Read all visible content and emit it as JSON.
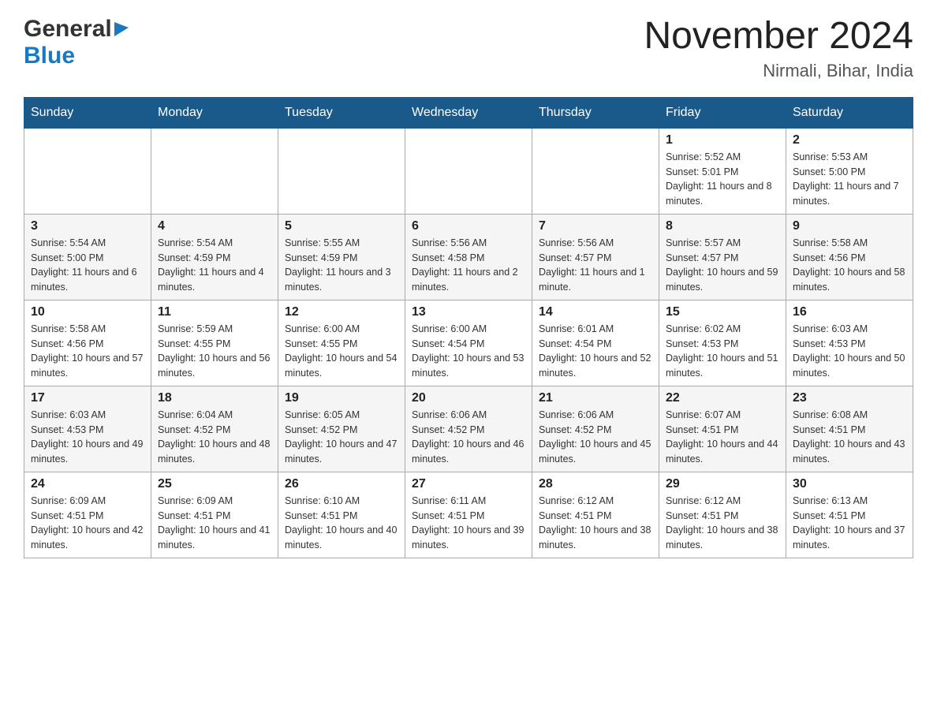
{
  "header": {
    "logo_general": "General",
    "logo_blue": "Blue",
    "month_title": "November 2024",
    "location": "Nirmali, Bihar, India"
  },
  "days_of_week": [
    "Sunday",
    "Monday",
    "Tuesday",
    "Wednesday",
    "Thursday",
    "Friday",
    "Saturday"
  ],
  "weeks": [
    [
      {
        "day": "",
        "info": ""
      },
      {
        "day": "",
        "info": ""
      },
      {
        "day": "",
        "info": ""
      },
      {
        "day": "",
        "info": ""
      },
      {
        "day": "",
        "info": ""
      },
      {
        "day": "1",
        "info": "Sunrise: 5:52 AM\nSunset: 5:01 PM\nDaylight: 11 hours and 8 minutes."
      },
      {
        "day": "2",
        "info": "Sunrise: 5:53 AM\nSunset: 5:00 PM\nDaylight: 11 hours and 7 minutes."
      }
    ],
    [
      {
        "day": "3",
        "info": "Sunrise: 5:54 AM\nSunset: 5:00 PM\nDaylight: 11 hours and 6 minutes."
      },
      {
        "day": "4",
        "info": "Sunrise: 5:54 AM\nSunset: 4:59 PM\nDaylight: 11 hours and 4 minutes."
      },
      {
        "day": "5",
        "info": "Sunrise: 5:55 AM\nSunset: 4:59 PM\nDaylight: 11 hours and 3 minutes."
      },
      {
        "day": "6",
        "info": "Sunrise: 5:56 AM\nSunset: 4:58 PM\nDaylight: 11 hours and 2 minutes."
      },
      {
        "day": "7",
        "info": "Sunrise: 5:56 AM\nSunset: 4:57 PM\nDaylight: 11 hours and 1 minute."
      },
      {
        "day": "8",
        "info": "Sunrise: 5:57 AM\nSunset: 4:57 PM\nDaylight: 10 hours and 59 minutes."
      },
      {
        "day": "9",
        "info": "Sunrise: 5:58 AM\nSunset: 4:56 PM\nDaylight: 10 hours and 58 minutes."
      }
    ],
    [
      {
        "day": "10",
        "info": "Sunrise: 5:58 AM\nSunset: 4:56 PM\nDaylight: 10 hours and 57 minutes."
      },
      {
        "day": "11",
        "info": "Sunrise: 5:59 AM\nSunset: 4:55 PM\nDaylight: 10 hours and 56 minutes."
      },
      {
        "day": "12",
        "info": "Sunrise: 6:00 AM\nSunset: 4:55 PM\nDaylight: 10 hours and 54 minutes."
      },
      {
        "day": "13",
        "info": "Sunrise: 6:00 AM\nSunset: 4:54 PM\nDaylight: 10 hours and 53 minutes."
      },
      {
        "day": "14",
        "info": "Sunrise: 6:01 AM\nSunset: 4:54 PM\nDaylight: 10 hours and 52 minutes."
      },
      {
        "day": "15",
        "info": "Sunrise: 6:02 AM\nSunset: 4:53 PM\nDaylight: 10 hours and 51 minutes."
      },
      {
        "day": "16",
        "info": "Sunrise: 6:03 AM\nSunset: 4:53 PM\nDaylight: 10 hours and 50 minutes."
      }
    ],
    [
      {
        "day": "17",
        "info": "Sunrise: 6:03 AM\nSunset: 4:53 PM\nDaylight: 10 hours and 49 minutes."
      },
      {
        "day": "18",
        "info": "Sunrise: 6:04 AM\nSunset: 4:52 PM\nDaylight: 10 hours and 48 minutes."
      },
      {
        "day": "19",
        "info": "Sunrise: 6:05 AM\nSunset: 4:52 PM\nDaylight: 10 hours and 47 minutes."
      },
      {
        "day": "20",
        "info": "Sunrise: 6:06 AM\nSunset: 4:52 PM\nDaylight: 10 hours and 46 minutes."
      },
      {
        "day": "21",
        "info": "Sunrise: 6:06 AM\nSunset: 4:52 PM\nDaylight: 10 hours and 45 minutes."
      },
      {
        "day": "22",
        "info": "Sunrise: 6:07 AM\nSunset: 4:51 PM\nDaylight: 10 hours and 44 minutes."
      },
      {
        "day": "23",
        "info": "Sunrise: 6:08 AM\nSunset: 4:51 PM\nDaylight: 10 hours and 43 minutes."
      }
    ],
    [
      {
        "day": "24",
        "info": "Sunrise: 6:09 AM\nSunset: 4:51 PM\nDaylight: 10 hours and 42 minutes."
      },
      {
        "day": "25",
        "info": "Sunrise: 6:09 AM\nSunset: 4:51 PM\nDaylight: 10 hours and 41 minutes."
      },
      {
        "day": "26",
        "info": "Sunrise: 6:10 AM\nSunset: 4:51 PM\nDaylight: 10 hours and 40 minutes."
      },
      {
        "day": "27",
        "info": "Sunrise: 6:11 AM\nSunset: 4:51 PM\nDaylight: 10 hours and 39 minutes."
      },
      {
        "day": "28",
        "info": "Sunrise: 6:12 AM\nSunset: 4:51 PM\nDaylight: 10 hours and 38 minutes."
      },
      {
        "day": "29",
        "info": "Sunrise: 6:12 AM\nSunset: 4:51 PM\nDaylight: 10 hours and 38 minutes."
      },
      {
        "day": "30",
        "info": "Sunrise: 6:13 AM\nSunset: 4:51 PM\nDaylight: 10 hours and 37 minutes."
      }
    ]
  ]
}
